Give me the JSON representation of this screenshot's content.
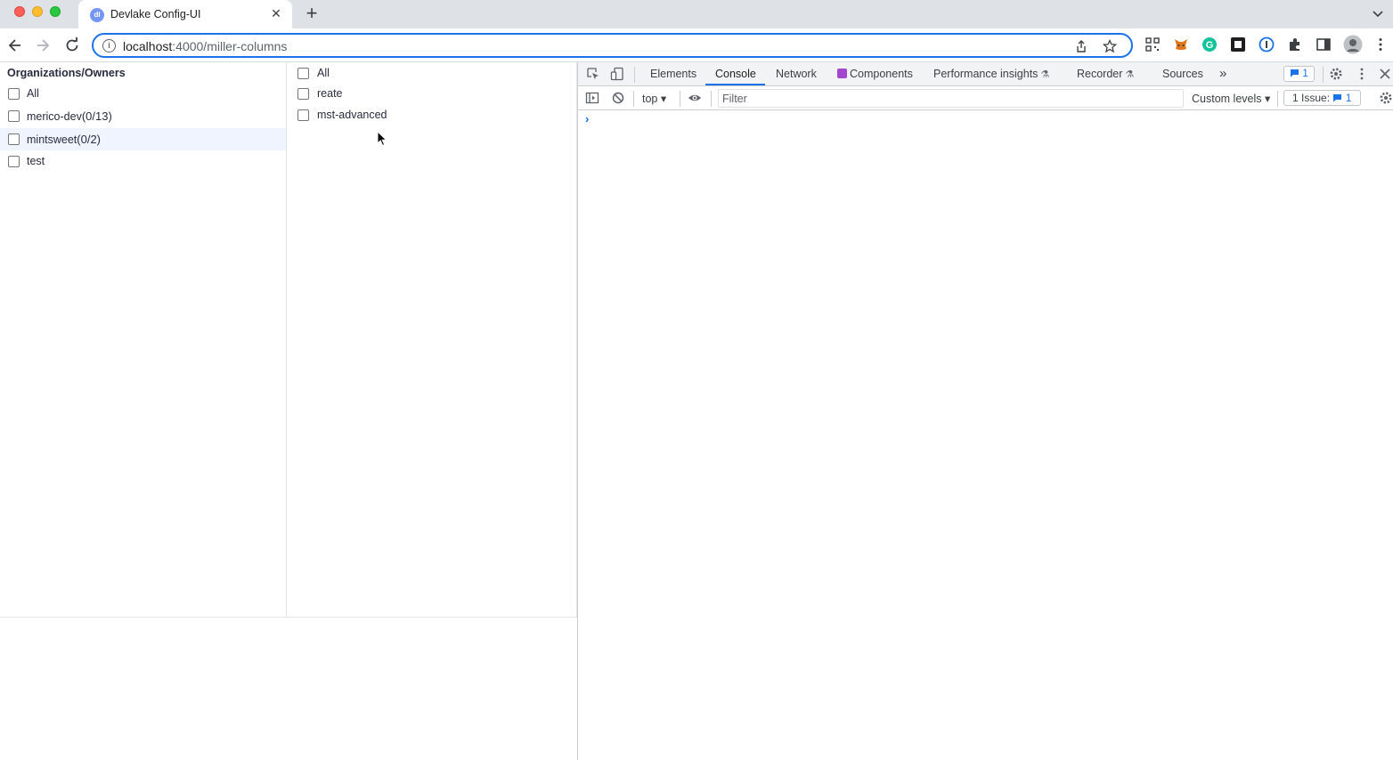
{
  "browser": {
    "tab_title": "Devlake Config-UI",
    "tab_favicon_text": "dl",
    "tab_close": "✕",
    "new_tab": "+",
    "url_host": "localhost",
    "url_rest": ":4000/miller-columns"
  },
  "columns": {
    "organizations": {
      "title": "Organizations/Owners",
      "items": [
        {
          "label": "All",
          "count": ""
        },
        {
          "label": "merico-dev",
          "count": "(0/13)"
        },
        {
          "label": "mintsweet",
          "count": "(0/2)"
        },
        {
          "label": "test",
          "count": ""
        }
      ]
    },
    "repos": {
      "items": [
        {
          "label": "All"
        },
        {
          "label": "reate"
        },
        {
          "label": "mst-advanced"
        }
      ]
    }
  },
  "devtools": {
    "tabs": [
      "Elements",
      "Console",
      "Network",
      "Components",
      "Performance insights",
      "Recorder",
      "Sources"
    ],
    "more": "»",
    "message_badge": "1",
    "context": "top ▾",
    "filter_placeholder": "Filter",
    "levels": "Custom levels ▾",
    "issues_label": "1 Issue:",
    "issues_count": "1",
    "prompt": "›"
  },
  "colors": {
    "accent": "#1a73e8",
    "tabstrip": "#dee1e6",
    "row_active": "#f0f4fe"
  }
}
